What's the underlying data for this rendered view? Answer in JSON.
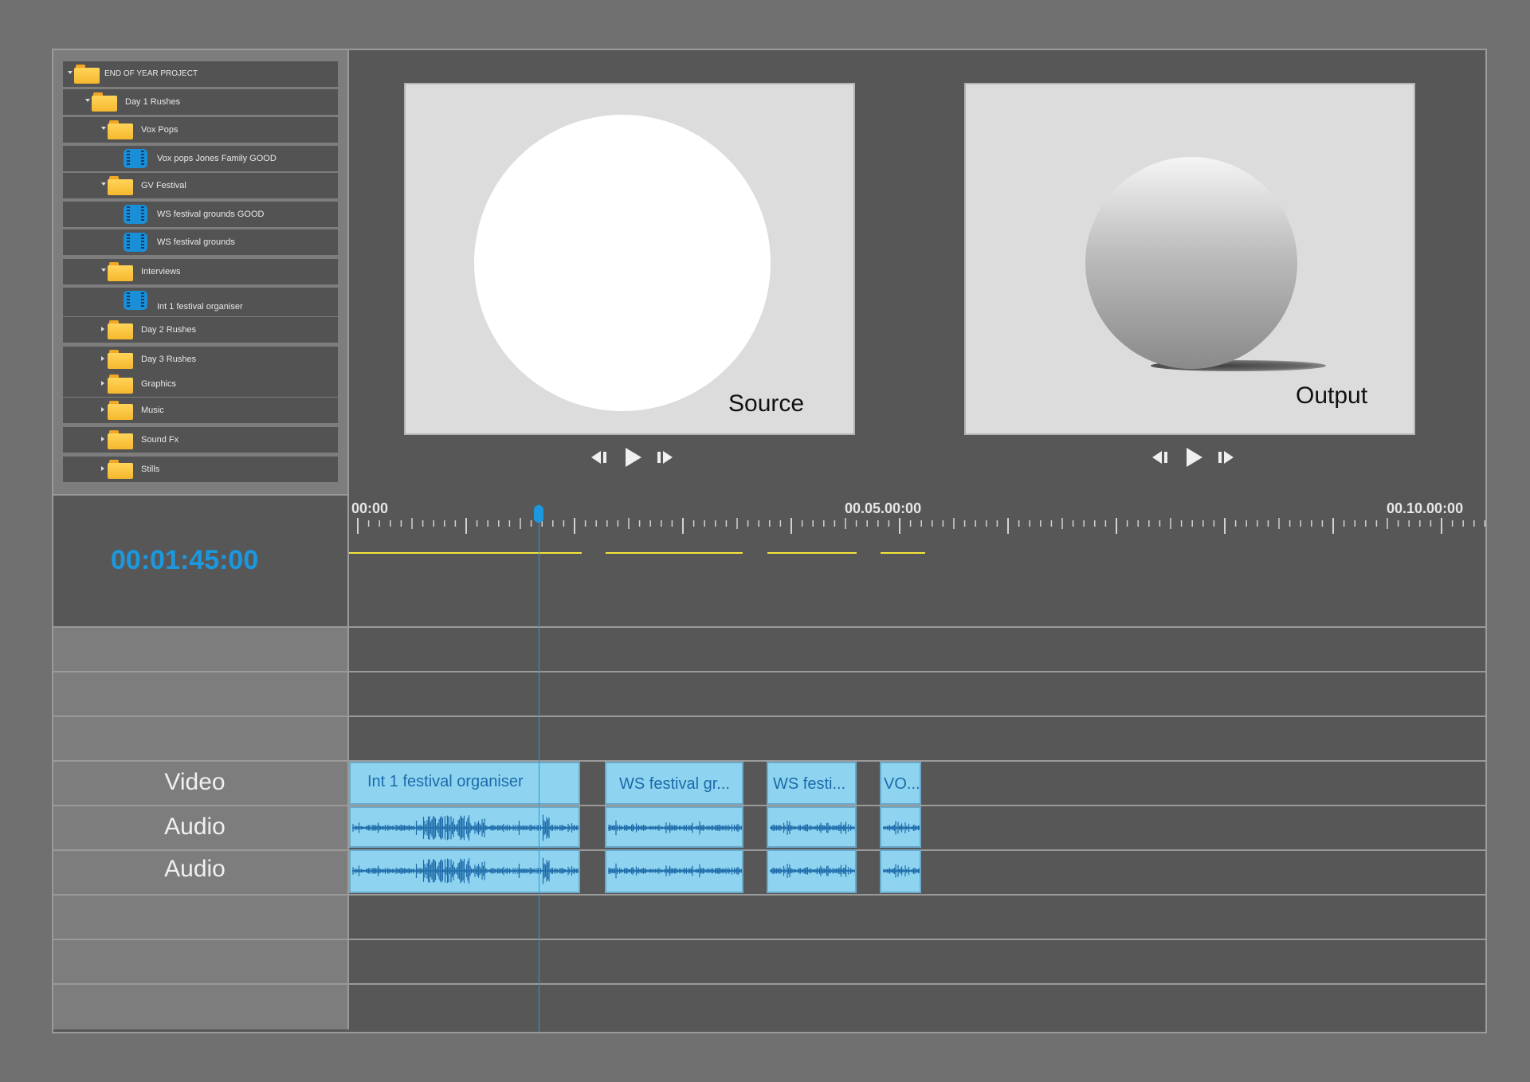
{
  "project_tree": [
    {
      "label": "END OF YEAR PROJECT",
      "type": "folder",
      "depth": 0,
      "expanded": true
    },
    {
      "label": "Day 1 Rushes",
      "type": "folder",
      "depth": 1,
      "expanded": true
    },
    {
      "label": "Vox Pops",
      "type": "folder",
      "depth": 2,
      "expanded": true
    },
    {
      "label": "Vox pops Jones Family GOOD",
      "type": "clip",
      "depth": 3
    },
    {
      "label": "GV Festival",
      "type": "folder",
      "depth": 2,
      "expanded": true
    },
    {
      "label": "WS festival grounds GOOD",
      "type": "clip",
      "depth": 3
    },
    {
      "label": "WS festival grounds",
      "type": "clip",
      "depth": 3
    },
    {
      "label": "Interviews",
      "type": "folder",
      "depth": 2,
      "expanded": true
    },
    {
      "label": "Int 1 festival organiser",
      "type": "clip",
      "depth": 3
    },
    {
      "label": "Day 2 Rushes",
      "type": "folder",
      "depth": 2,
      "expanded": false
    },
    {
      "label": "Day 3 Rushes",
      "type": "folder",
      "depth": 2,
      "expanded": false
    },
    {
      "label": "Graphics",
      "type": "folder",
      "depth": 2,
      "expanded": false
    },
    {
      "label": "Music",
      "type": "folder",
      "depth": 2,
      "expanded": false
    },
    {
      "label": "Sound Fx",
      "type": "folder",
      "depth": 2,
      "expanded": false
    },
    {
      "label": "Stills",
      "type": "folder",
      "depth": 2,
      "expanded": false
    }
  ],
  "monitors": {
    "source_label": "Source",
    "output_label": "Output"
  },
  "timecode": "00:01:45:00",
  "ruler": {
    "labels": [
      "00:00",
      "00.05.00:00",
      "00.10.00:00"
    ]
  },
  "tracks": {
    "video_label": "Video",
    "audio1_label": "Audio",
    "audio2_label": "Audio"
  },
  "clips": [
    {
      "title": "Int 1 festival organiser"
    },
    {
      "title": "WS festival gr..."
    },
    {
      "title": "WS festi..."
    },
    {
      "title": "VO..."
    }
  ],
  "icons": [
    "folder-icon",
    "film-clip-icon",
    "step-back-icon",
    "play-icon",
    "step-forward-icon",
    "playhead-icon"
  ],
  "colors": {
    "accent": "#1b98e0",
    "clip": "#8ed4f1",
    "waveform": "#1d6aa9",
    "render_bar": "#f2e33a",
    "folder": "#f6b82d"
  }
}
